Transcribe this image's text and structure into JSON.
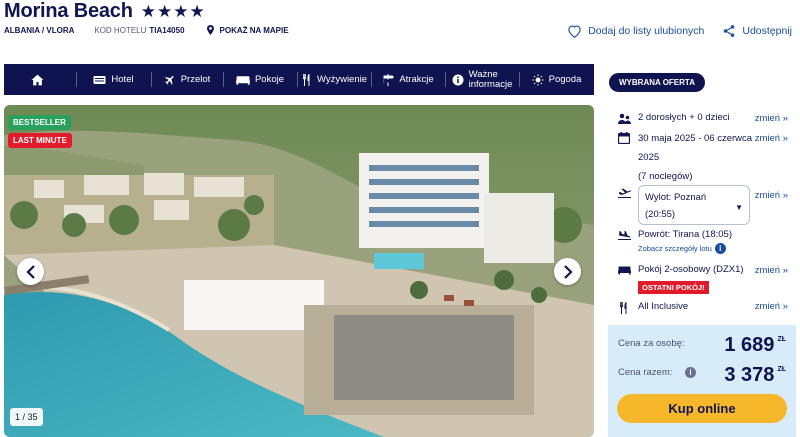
{
  "hotel": {
    "name": "Morina Beach",
    "stars": "★★★★",
    "location": "ALBANIA / VLORA",
    "code_label": "KOD HOTELU",
    "code": "TIA14050",
    "map_link": "POKAŻ NA MAPIE"
  },
  "actions": {
    "favorite": "Dodaj do listy ulubionych",
    "share": "Udostępnij"
  },
  "nav": {
    "hotel": "Hotel",
    "flight": "Przelot",
    "rooms": "Pokoje",
    "food": "Wyżywienie",
    "attractions": "Atrakcje",
    "info_line1": "Ważne",
    "info_line2": "informacje",
    "weather": "Pogoda"
  },
  "gallery": {
    "badge_bestseller": "BESTSELLER",
    "badge_last_minute": "LAST MINUTE",
    "counter": "1 / 35"
  },
  "offer": {
    "tag": "WYBRANA OFERTA",
    "change_label": "zmień »",
    "people": "2 dorosłych + 0 dzieci",
    "dates_line1": "30 maja 2025 - 06 czerwca",
    "dates_line2": "2025",
    "dates_line3": "(7 noclegów)",
    "departure_line1": "Wylot: Poznań",
    "departure_line2": "(20:55)",
    "return": "Powrót: Tirana (18:05)",
    "flight_details": "Zobacz szczegóły lotu",
    "room": "Pokój 2-osobowy (DZX1)",
    "last_rooms": "OSTATNI POKÓJ!",
    "board": "All Inclusive"
  },
  "price": {
    "per_person_label": "Cena za osobę:",
    "per_person": "1 689",
    "total_label": "Cena razem:",
    "total": "3 378",
    "currency": "ZŁ",
    "buy": "Kup online"
  },
  "colors": {
    "navy": "#0f1350",
    "link": "#1a4d9e",
    "buy": "#f6b82a",
    "badge_green": "#28a15f",
    "badge_red": "#e21b2b",
    "price_bg": "#d8ebf8"
  }
}
